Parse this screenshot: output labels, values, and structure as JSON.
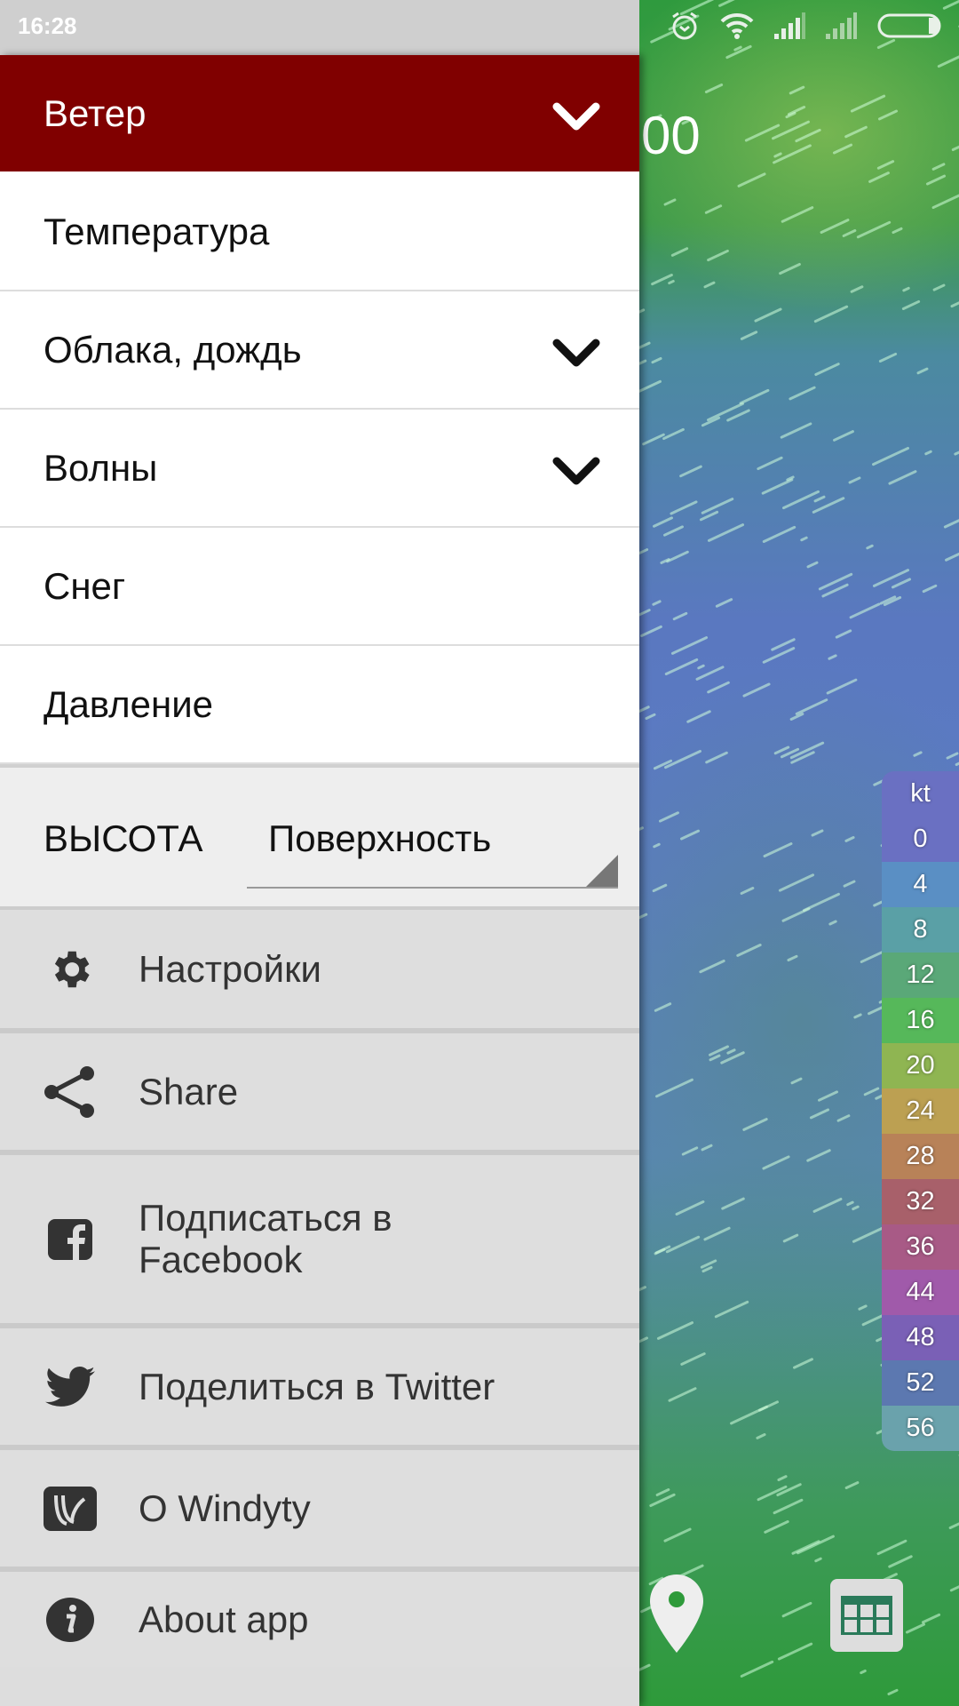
{
  "status_bar": {
    "time": "16:28"
  },
  "map": {
    "partial_text": "00"
  },
  "layers": [
    {
      "label": "Ветер",
      "active": true,
      "expandable": true
    },
    {
      "label": "Температура",
      "active": false,
      "expandable": false
    },
    {
      "label": "Облака, дождь",
      "active": false,
      "expandable": true
    },
    {
      "label": "Волны",
      "active": false,
      "expandable": true
    },
    {
      "label": "Снег",
      "active": false,
      "expandable": false
    },
    {
      "label": "Давление",
      "active": false,
      "expandable": false
    }
  ],
  "height": {
    "label": "ВЫСОТА",
    "value": "Поверхность"
  },
  "menu": [
    {
      "label": "Настройки",
      "icon": "gear-icon"
    },
    {
      "label": "Share",
      "icon": "share-icon"
    },
    {
      "label": "Подписаться в Facebook",
      "icon": "facebook-icon"
    },
    {
      "label": "Поделиться в Twitter",
      "icon": "twitter-icon"
    },
    {
      "label": "O Windyty",
      "icon": "windyty-icon"
    },
    {
      "label": "About app",
      "icon": "info-icon"
    }
  ],
  "legend": {
    "unit": "kt",
    "values": [
      "0",
      "4",
      "8",
      "12",
      "16",
      "20",
      "24",
      "28",
      "32",
      "36",
      "44",
      "48",
      "52",
      "56"
    ],
    "colors": [
      "#6a70c2",
      "#5a8fc4",
      "#5aa0a6",
      "#5aa878",
      "#56b85a",
      "#8fb552",
      "#bca052",
      "#b88258",
      "#a8606a",
      "#a85a86",
      "#a05aaa",
      "#7a60b6",
      "#5c78b0",
      "#6aa2ac"
    ],
    "unit_color": "#6a70c2"
  },
  "colors": {
    "active_layer": "#800000"
  }
}
